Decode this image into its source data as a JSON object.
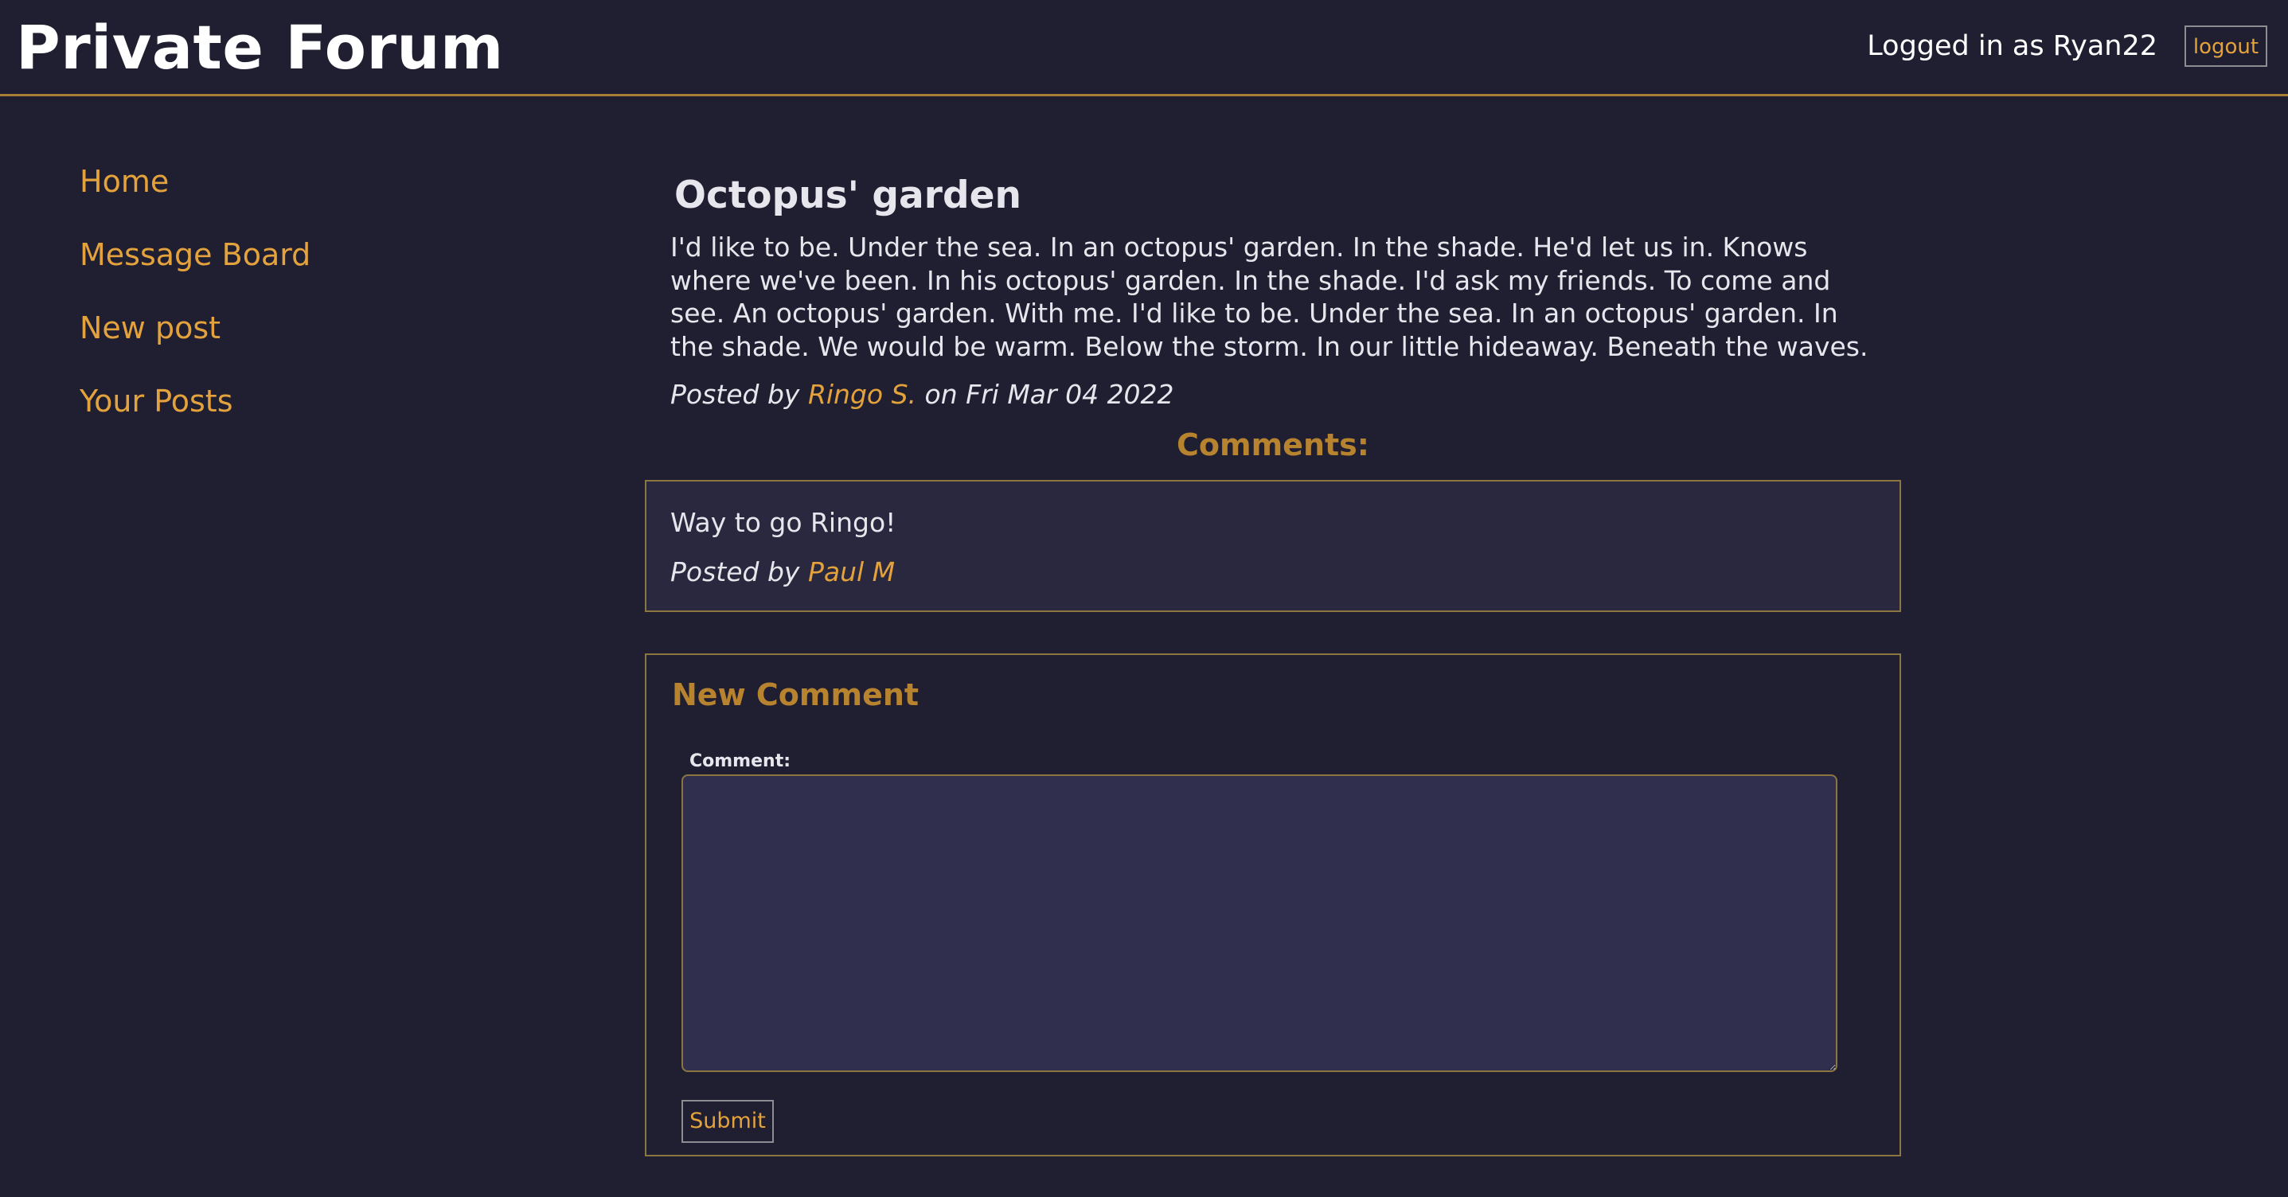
{
  "header": {
    "site_title": "Private Forum",
    "login_status": "Logged in as Ryan22",
    "logout_label": "logout"
  },
  "sidebar": {
    "items": [
      {
        "label": "Home"
      },
      {
        "label": "Message Board"
      },
      {
        "label": "New post"
      },
      {
        "label": "Your Posts"
      }
    ]
  },
  "post": {
    "title": "Octopus' garden",
    "body": "I'd like to be. Under the sea. In an octopus' garden. In the shade. He'd let us in. Knows where we've been. In his octopus' garden. In the shade. I'd ask my friends. To come and see. An octopus' garden. With me. I'd like to be. Under the sea. In an octopus' garden. In the shade. We would be warm. Below the storm. In our little hideaway. Beneath the waves.",
    "posted_by_prefix": "Posted by",
    "author": "Ringo S.",
    "date_text": "on Fri Mar 04 2022"
  },
  "comments": {
    "heading": "Comments:",
    "items": [
      {
        "text": "Way to go Ringo!",
        "posted_by_prefix": "Posted by",
        "author": "Paul M"
      }
    ]
  },
  "new_comment": {
    "title": "New Comment",
    "field_label": "Comment:",
    "value": "",
    "submit_label": "Submit"
  },
  "colors": {
    "background": "#201f32",
    "accent": "#e4a23c",
    "heading_accent": "#b7832e",
    "border": "#8a7641",
    "input_background": "#302f4d"
  }
}
